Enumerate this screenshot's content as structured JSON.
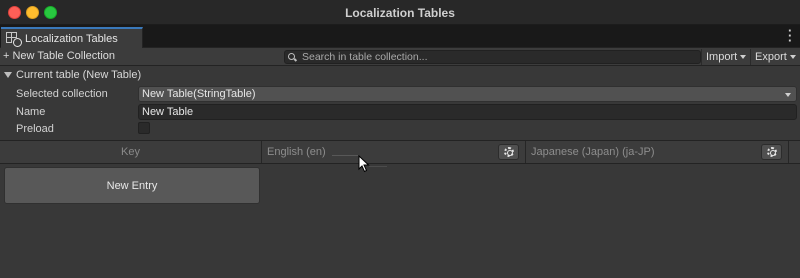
{
  "window": {
    "title": "Localization Tables"
  },
  "tab": {
    "label": "Localization Tables"
  },
  "toolbar": {
    "new_collection_label": "+ New Table Collection",
    "search_placeholder": "Search in table collection...",
    "import_label": "Import",
    "export_label": "Export"
  },
  "current_table": {
    "header": "Current table (New Table)",
    "selected_collection_label": "Selected collection",
    "selected_collection_value": "New Table(StringTable)",
    "name_label": "Name",
    "name_value": "New Table",
    "preload_label": "Preload",
    "preload_checked": false
  },
  "columns": [
    {
      "label": "Key",
      "has_settings": false
    },
    {
      "label": "English (en)",
      "has_settings": true
    },
    {
      "label": "Japanese (Japan) (ja-JP)",
      "has_settings": true
    }
  ],
  "actions": {
    "new_entry_label": "New Entry"
  },
  "icons": {
    "tab": "localization-tables-icon",
    "search": "search-icon",
    "column_settings": "gear-icon",
    "foldout": "foldout-arrow-icon",
    "menu": "more-vertical-icon"
  }
}
